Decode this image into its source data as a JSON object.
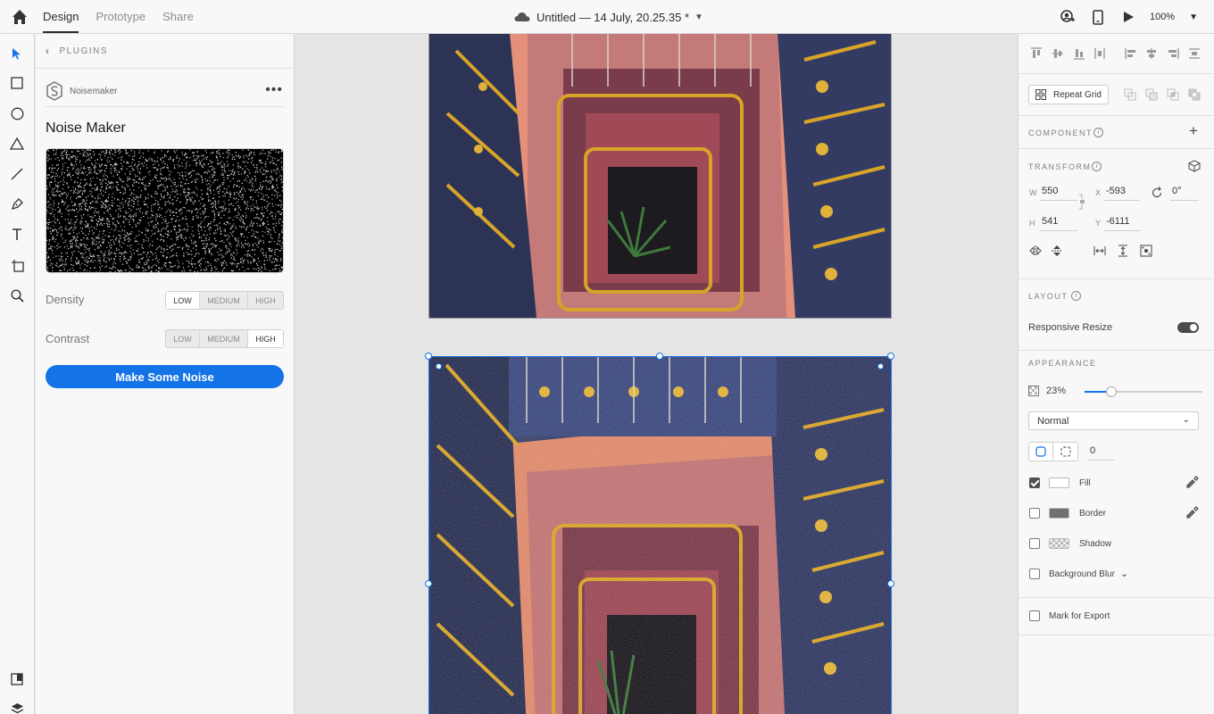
{
  "topbar": {
    "tabs": [
      {
        "label": "Design"
      },
      {
        "label": "Prototype"
      },
      {
        "label": "Share"
      }
    ],
    "document_title": "Untitled — 14 July, 20.25.35 *",
    "zoom": "100%"
  },
  "plugin_panel": {
    "header": "PLUGINS",
    "plugin_name": "Noisemaker",
    "title": "Noise Maker",
    "density": {
      "label": "Density",
      "options": [
        "LOW",
        "MEDIUM",
        "HIGH"
      ],
      "selected": "LOW"
    },
    "contrast": {
      "label": "Contrast",
      "options": [
        "LOW",
        "MEDIUM",
        "HIGH"
      ],
      "selected": "HIGH"
    },
    "action_button": "Make Some Noise"
  },
  "inspector": {
    "repeat_grid": "Repeat Grid",
    "component_title": "COMPONENT",
    "transform_title": "TRANSFORM",
    "transform": {
      "w_label": "W",
      "w": "550",
      "h_label": "H",
      "h": "541",
      "x_label": "X",
      "x": "-593",
      "y_label": "Y",
      "y": "-6111",
      "rotation": "0°"
    },
    "layout_title": "LAYOUT",
    "responsive_resize": "Responsive Resize",
    "responsive_resize_on": true,
    "appearance_title": "APPEARANCE",
    "opacity": "23%",
    "opacity_value": 0.23,
    "blend_mode": "Normal",
    "corner_radius": "0",
    "fill": {
      "label": "Fill",
      "checked": true,
      "color": "#ffffff"
    },
    "border": {
      "label": "Border",
      "checked": false,
      "color": "#707070"
    },
    "shadow": {
      "label": "Shadow",
      "checked": false
    },
    "background_blur": {
      "label": "Background Blur",
      "checked": false
    },
    "export": {
      "label": "Mark for Export",
      "checked": false
    }
  },
  "colors": {
    "accent": "#1473e6",
    "panel": "#f8f8f8",
    "canvas": "#e5e5e5"
  },
  "icons": {
    "toolbar": [
      "select-icon",
      "rectangle-icon",
      "ellipse-icon",
      "triangle-icon",
      "line-icon",
      "pen-icon",
      "text-icon",
      "artboard-icon",
      "zoom-icon",
      "assets-icon",
      "layers-icon"
    ],
    "top_right": [
      "share-user-icon",
      "device-preview-icon",
      "play-icon"
    ]
  }
}
